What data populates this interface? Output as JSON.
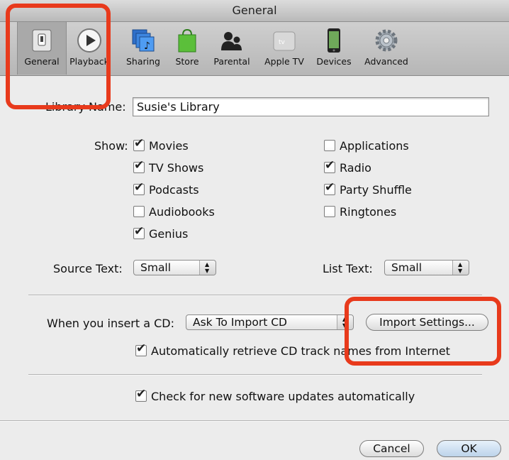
{
  "window": {
    "title": "General"
  },
  "toolbar": {
    "items": [
      {
        "label": "General",
        "icon": "general-switch-icon",
        "selected": true
      },
      {
        "label": "Playback",
        "icon": "play-icon"
      },
      {
        "label": "Sharing",
        "icon": "sharing-icon"
      },
      {
        "label": "Store",
        "icon": "shopping-bag-icon"
      },
      {
        "label": "Parental",
        "icon": "parental-icon"
      },
      {
        "label": "Apple TV",
        "icon": "apple-tv-icon"
      },
      {
        "label": "Devices",
        "icon": "iphone-icon"
      },
      {
        "label": "Advanced",
        "icon": "gear-icon"
      }
    ]
  },
  "library": {
    "label": "Library Name:",
    "value": "Susie's Library"
  },
  "show": {
    "label": "Show:",
    "left": [
      {
        "label": "Movies",
        "checked": true
      },
      {
        "label": "TV Shows",
        "checked": true
      },
      {
        "label": "Podcasts",
        "checked": true
      },
      {
        "label": "Audiobooks",
        "checked": false
      },
      {
        "label": "Genius",
        "checked": true
      }
    ],
    "right": [
      {
        "label": "Applications",
        "checked": false
      },
      {
        "label": "Radio",
        "checked": true
      },
      {
        "label": "Party Shuffle",
        "checked": true
      },
      {
        "label": "Ringtones",
        "checked": false
      }
    ]
  },
  "source_text": {
    "label": "Source Text:",
    "value": "Small"
  },
  "list_text": {
    "label": "List Text:",
    "value": "Small"
  },
  "cd": {
    "label": "When you insert a CD:",
    "value": "Ask To Import CD",
    "import_button": "Import Settings..."
  },
  "auto_retrieve": {
    "label": "Automatically retrieve CD track names from Internet",
    "checked": true
  },
  "updates": {
    "label": "Check for new software updates automatically",
    "checked": true
  },
  "buttons": {
    "cancel": "Cancel",
    "ok": "OK"
  },
  "colors": {
    "highlight": "#e83a1c",
    "window_bg": "#ececec"
  }
}
